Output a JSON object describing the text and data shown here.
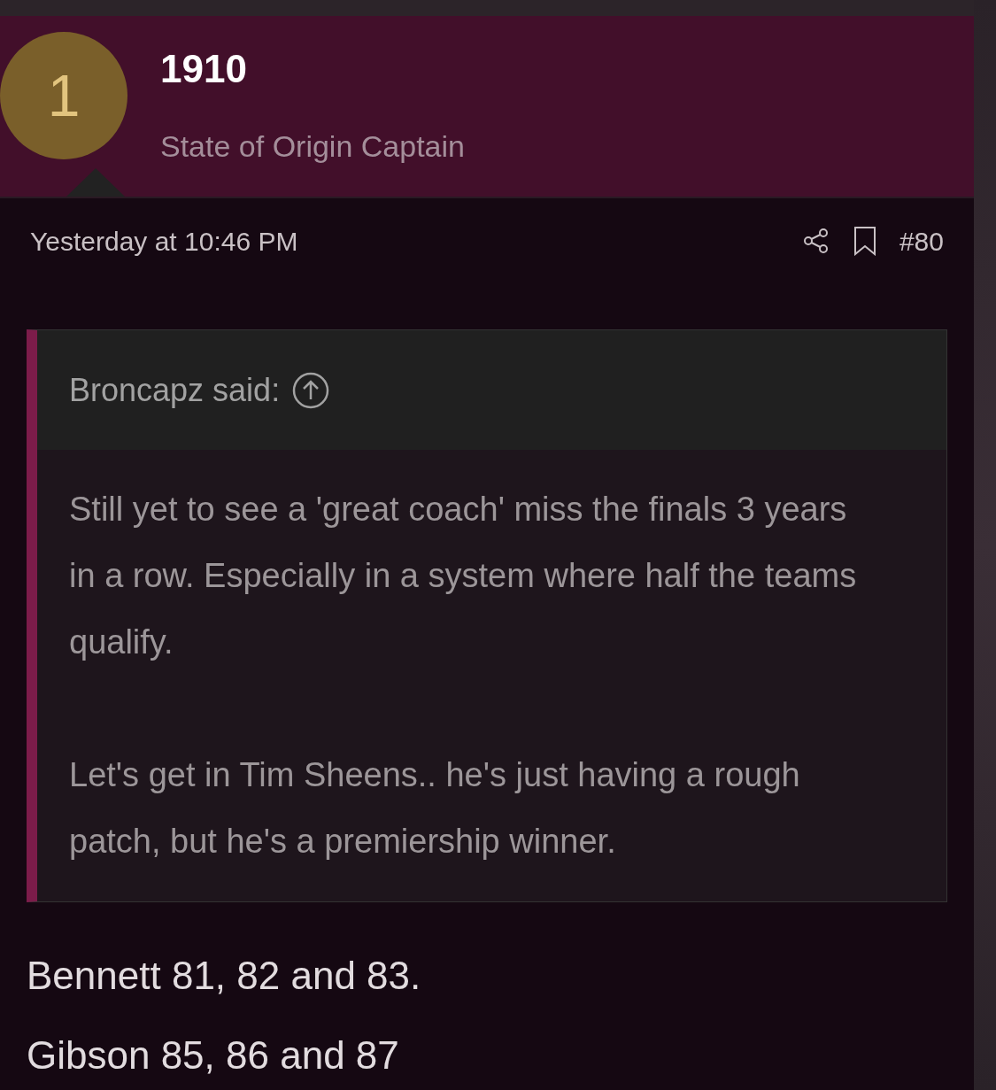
{
  "post_header": {
    "avatar_letter": "1",
    "username": "1910",
    "user_title": "State of Origin Captain"
  },
  "meta": {
    "time": "Yesterday at 10:46 PM",
    "post_number": "#80"
  },
  "quote": {
    "attribution": "Broncapz said:",
    "paragraphs": [
      "Still yet to see a 'great coach' miss the finals 3 years in a row. Especially in a system where half the teams qualify.",
      "Let's get in Tim Sheens.. he's just having a rough patch, but he's a premiership winner."
    ]
  },
  "body": [
    "Bennett 81, 82 and 83.",
    "Gibson 85, 86 and 87"
  ]
}
